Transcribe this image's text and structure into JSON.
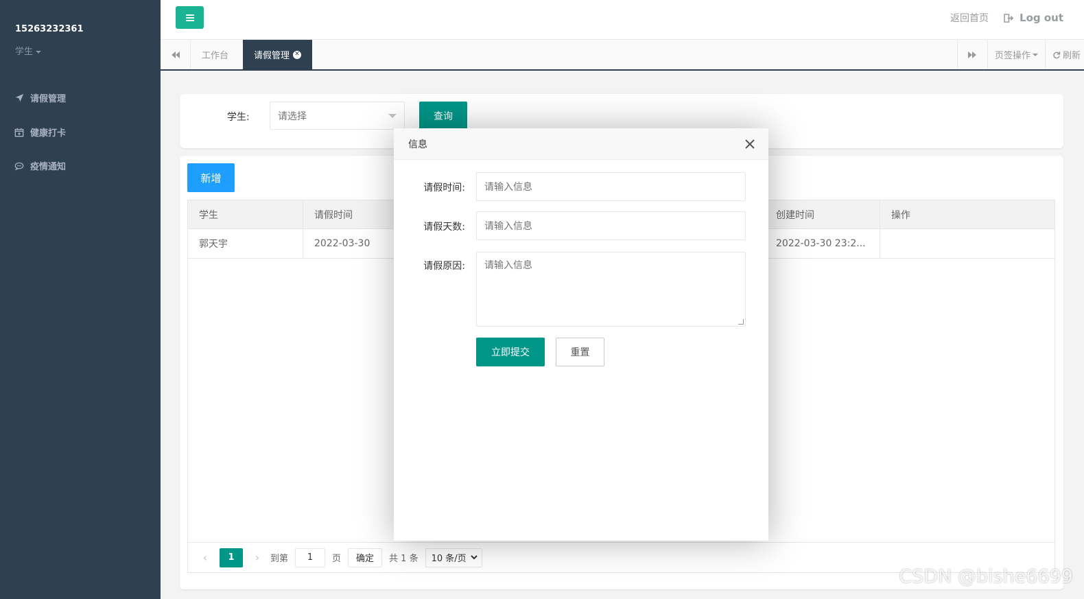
{
  "sidebar": {
    "user_name": "15263232361",
    "user_role": "学生",
    "items": [
      {
        "label": "请假管理",
        "icon": "paper-plane-icon"
      },
      {
        "label": "健康打卡",
        "icon": "calendar-plus-icon"
      },
      {
        "label": "疫情通知",
        "icon": "comment-icon"
      }
    ]
  },
  "header": {
    "back_home": "返回首页",
    "logout": "Log out"
  },
  "tabs": {
    "items": [
      {
        "label": "工作台"
      },
      {
        "label": "请假管理"
      }
    ],
    "page_ops": "页签操作",
    "refresh": "刷新"
  },
  "search": {
    "label": "学生:",
    "select_placeholder": "请选择",
    "query_button": "查询"
  },
  "table": {
    "add_button": "新增",
    "columns": [
      "学生",
      "请假时间",
      "",
      "",
      "创建时间",
      "操作"
    ],
    "rows": [
      [
        "郭天宇",
        "2022-03-30",
        "",
        "",
        "2022-03-30 23:2...",
        ""
      ]
    ]
  },
  "pager": {
    "current_page": "1",
    "goto_label": "到第",
    "goto_value": "1",
    "page_unit": "页",
    "confirm": "确定",
    "total": "共 1 条",
    "page_size": "10 条/页"
  },
  "modal": {
    "title": "信息",
    "fields": [
      {
        "label": "请假时间:",
        "placeholder": "请输入信息"
      },
      {
        "label": "请假天数:",
        "placeholder": "请输入信息"
      },
      {
        "label": "请假原因:",
        "placeholder": "请输入信息"
      }
    ],
    "submit": "立即提交",
    "reset": "重置"
  },
  "watermark": "CSDN @bishe6699",
  "colors": {
    "sidebar_bg": "#2f4050",
    "primary_green": "#009688",
    "toggle_green": "#1ab394",
    "blue": "#1e9fff"
  }
}
